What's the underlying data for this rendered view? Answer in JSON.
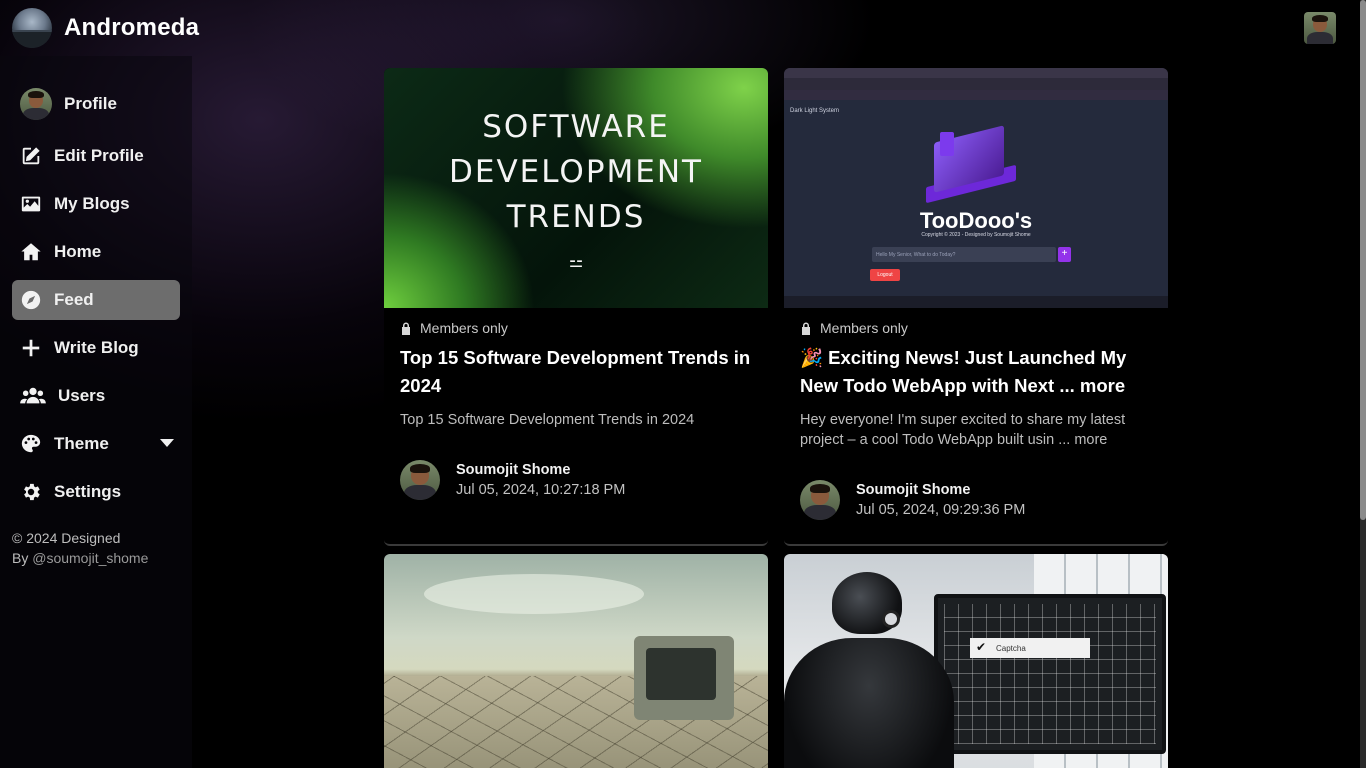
{
  "brand": {
    "name": "Andromeda"
  },
  "sidebar": {
    "items": [
      {
        "label": "Profile",
        "icon": "avatar"
      },
      {
        "label": "Edit Profile",
        "icon": "edit-icon"
      },
      {
        "label": "My Blogs",
        "icon": "image-icon"
      },
      {
        "label": "Home",
        "icon": "home-icon"
      },
      {
        "label": "Feed",
        "icon": "compass-icon",
        "active": true
      },
      {
        "label": "Write Blog",
        "icon": "plus-icon"
      },
      {
        "label": "Users",
        "icon": "users-icon"
      },
      {
        "label": "Theme",
        "icon": "palette-icon"
      },
      {
        "label": "Settings",
        "icon": "gear-icon"
      }
    ],
    "copyright_line1": "© 2024 Designed",
    "copyright_by": "By ",
    "copyright_handle": "@soumojit_shome"
  },
  "posts": [
    {
      "badge": "Members only",
      "title": "Top 15 Software Development Trends in 2024",
      "summary": "Top 15 Software Development Trends in 2024",
      "author": "Soumojit Shome",
      "date": "Jul 05, 2024, 10:27:18 PM",
      "image_text": [
        "SOFTWARE",
        "DEVELOPMENT",
        "TRENDS"
      ]
    },
    {
      "badge": "Members only",
      "title": "🎉 Exciting News! Just Launched My New Todo WebApp with Next ... more",
      "summary": "Hey everyone! I'm super excited to share my latest project – a cool Todo WebApp built usin ... more",
      "author": "Soumojit Shome",
      "date": "Jul 05, 2024, 09:29:36 PM",
      "image_text": {
        "app_title": "TooDooo's",
        "copyright": "Copyright © 2023 - Designed by Soumojit Shome",
        "input_placeholder": "Hello My Senior, What to do Today?",
        "logout": "Logout",
        "modes": "Dark   Light   System"
      }
    },
    {
      "image_theme": "desert-computer"
    },
    {
      "image_theme": "robot-captcha",
      "image_text": {
        "captcha": "Captcha"
      }
    }
  ],
  "colors": {
    "active_nav": "#6d6d6d",
    "background": "#000000"
  }
}
